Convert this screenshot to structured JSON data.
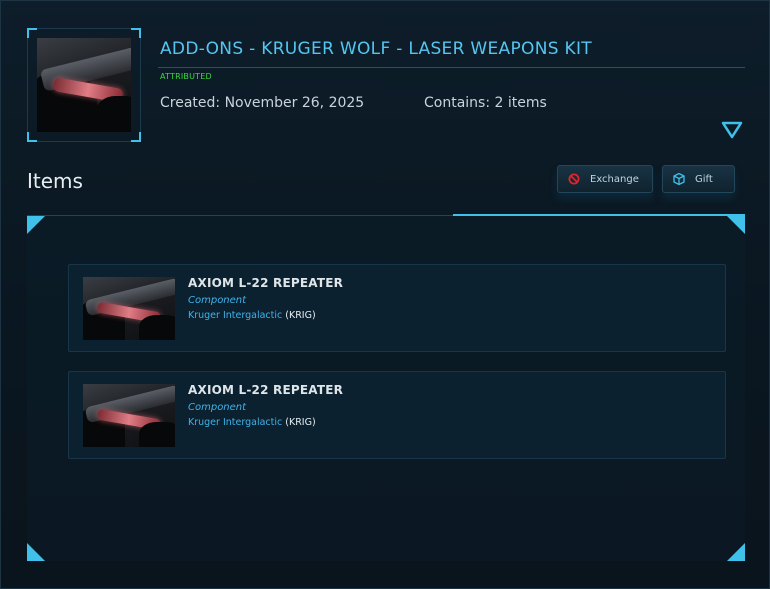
{
  "header": {
    "title": "ADD-ONS - KRUGER WOLF - LASER WEAPONS KIT",
    "status": "ATTRIBUTED",
    "created": "Created: November 26, 2025",
    "contains": "Contains: 2 items",
    "thumbnail_icon": "ship-thumbnail",
    "expand_icon": "chevron-down-icon"
  },
  "items_section": {
    "heading": "Items",
    "buttons": [
      {
        "label": "Exchange",
        "icon": "exchange-icon",
        "icon_color": "#e0242b"
      },
      {
        "label": "Gift",
        "icon": "gift-icon",
        "icon_color": "#3fc1ea"
      }
    ]
  },
  "items": [
    {
      "name": "AXIOM L-22 REPEATER",
      "type": "Component",
      "manufacturer": "Kruger Intergalactic",
      "manufacturer_code": "KRIG"
    },
    {
      "name": "AXIOM L-22 REPEATER",
      "type": "Component",
      "manufacturer": "Kruger Intergalactic",
      "manufacturer_code": "KRIG"
    }
  ],
  "colors": {
    "accent": "#3fc1ea",
    "title": "#55c6f0",
    "status_green": "#3bd93f",
    "background": "#0b1822"
  }
}
